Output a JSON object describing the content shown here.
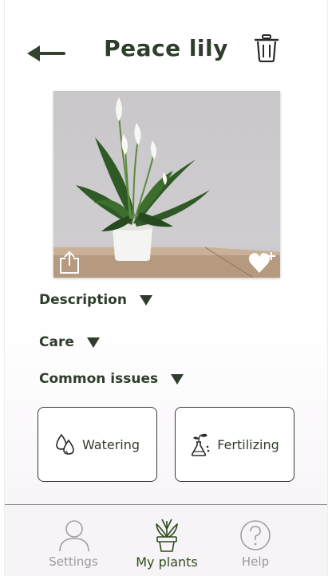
{
  "header": {
    "title": "Peace lily",
    "back_icon": "back-arrow-icon",
    "delete_icon": "trash-icon"
  },
  "photo": {
    "subject": "peace-lily-photo",
    "share_icon": "share-icon",
    "favorite_icon": "heart-plus-icon"
  },
  "sections": [
    {
      "label": "Description",
      "icon": "caret-down-icon"
    },
    {
      "label": "Care",
      "icon": "caret-down-icon"
    },
    {
      "label": "Common issues",
      "icon": "caret-down-icon"
    }
  ],
  "actions": [
    {
      "label": "Watering",
      "icon": "water-drops-icon"
    },
    {
      "label": "Fertilizing",
      "icon": "fertilizer-icon"
    }
  ],
  "tabbar": {
    "items": [
      {
        "label": "Settings",
        "icon": "user-icon",
        "active": false
      },
      {
        "label": "My plants",
        "icon": "potted-plant-icon",
        "active": true
      },
      {
        "label": "Help",
        "icon": "help-circle-icon",
        "active": false
      }
    ]
  },
  "colors": {
    "primary_text": "#2f3d2c",
    "active_tab": "#2f4a1c",
    "inactive_tab": "#9a9a9a"
  }
}
